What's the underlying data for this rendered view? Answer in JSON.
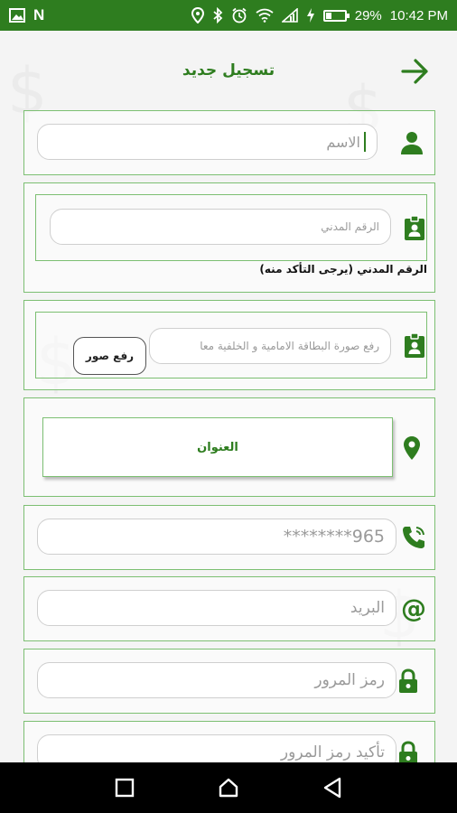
{
  "status_bar": {
    "battery_percent": "29%",
    "battery_level": 0.29,
    "time": "10:42 PM",
    "left_letter": "N",
    "icons": [
      "image-icon",
      "n-icon",
      "location-icon",
      "bluetooth-icon",
      "alarm-icon",
      "wifi-icon",
      "signal-icon",
      "charging-icon",
      "battery-icon"
    ]
  },
  "header": {
    "title": "تسجيل جديد",
    "back_icon": "arrow-right-icon"
  },
  "form": {
    "name": {
      "placeholder": "الاسم",
      "icon": "person-icon"
    },
    "civil_id": {
      "placeholder": "الرقم المدني",
      "icon": "id-card-icon",
      "note": "الرقم المدني (يرجى التأكد منه)"
    },
    "id_upload": {
      "placeholder": "رفع صورة البطاقة الامامية و الخلفية معا",
      "button_label": "رفع صور",
      "icon": "id-card-icon"
    },
    "address": {
      "button_label": "العنوان",
      "icon": "location-pin-icon"
    },
    "phone": {
      "placeholder": "965********",
      "icon": "phone-icon"
    },
    "email": {
      "placeholder": "البريد",
      "icon": "at-icon"
    },
    "password": {
      "placeholder": "رمز المرور",
      "icon": "lock-icon"
    },
    "confirm_password": {
      "placeholder": "تأكيد رمز المرور",
      "icon": "lock-icon"
    }
  },
  "colors": {
    "primary": "#2e7d1f",
    "border": "#7cbf72"
  }
}
